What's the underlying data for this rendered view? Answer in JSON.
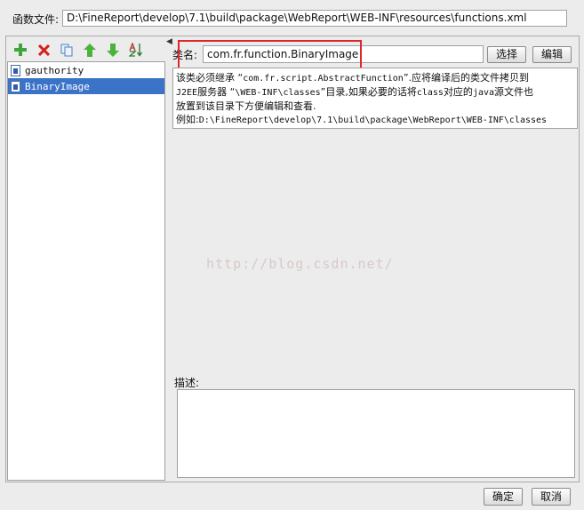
{
  "path": {
    "label": "函数文件:",
    "value": "D:\\FineReport\\develop\\7.1\\build\\package\\WebReport\\WEB-INF\\resources\\functions.xml"
  },
  "toolbar": {
    "add_icon": "plus-icon",
    "delete_icon": "delete-x-icon",
    "copy_icon": "copy-icon",
    "move_up_icon": "arrow-up-icon",
    "move_down_icon": "arrow-down-icon",
    "sort_icon": "sort-az-icon"
  },
  "functions": [
    {
      "name": "gauthority",
      "selected": false
    },
    {
      "name": "BinaryImage",
      "selected": true
    }
  ],
  "class_field": {
    "label": "类名:",
    "value": "com.fr.function.BinaryImage",
    "choose_button": "选择",
    "edit_button": "编辑"
  },
  "info": {
    "line1_prefix": "该类必须继承 “",
    "line1_code": "com.fr.script.AbstractFunction",
    "line1_suffix": "”.应将编译后的类文件拷贝到",
    "line2_code_a": "J2EE",
    "line2_text_a": "服务器 “",
    "line2_code_b": "\\WEB-INF\\classes",
    "line2_text_b": "”目录,如果必要的话将",
    "line2_code_c": "class",
    "line2_text_c": "对应的",
    "line2_code_d": "java",
    "line2_text_d": "源文件也",
    "line3": "放置到该目录下方便编辑和查看.",
    "line4_prefix": "例如:",
    "line4_code": "D:\\FineReport\\develop\\7.1\\build\\package\\WebReport\\WEB-INF\\classes"
  },
  "watermark": "http://blog.csdn.net/",
  "description": {
    "label": "描述:",
    "value": ""
  },
  "footer": {
    "ok_button": "确定",
    "cancel_button": "取消"
  },
  "colors": {
    "selection": "#3b73c8",
    "highlight": "#e0262b"
  }
}
